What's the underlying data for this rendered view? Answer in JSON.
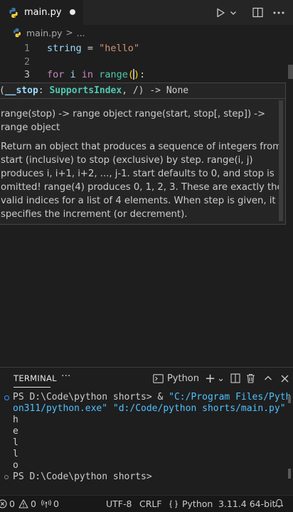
{
  "tab": {
    "filename": "main.py"
  },
  "breadcrumb": {
    "file": "main.py",
    "separator": ">",
    "symbol": "..."
  },
  "editor": {
    "lines": [
      {
        "number": "1",
        "tokens": [
          "string",
          " = ",
          "\"hello\""
        ]
      },
      {
        "number": "2"
      },
      {
        "number": "3",
        "tokens": [
          "for",
          " i ",
          "in",
          " ",
          "range",
          "(",
          ")",
          ":"
        ]
      }
    ]
  },
  "hover": {
    "signature": {
      "open": "(",
      "param": "__stop",
      "colon": ": ",
      "type": "SupportsIndex",
      "rest": ", /) -> None"
    },
    "doc1": "range(stop) -> range object range(start, stop[, step]) -> range object",
    "doc2": "Return an object that produces a sequence of integers from start (inclusive) to stop (exclusive) by step. range(i, j) produces i, i+1, i+2, ..., j-1. start defaults to 0, and stop is omitted! range(4) produces 0, 1, 2, 3. These are exactly the valid indices for a list of 4 elements. When step is given, it specifies the increment (or decrement)."
  },
  "panel": {
    "tab_label": "TERMINAL",
    "more": "···",
    "shell": "Python",
    "add": "+",
    "dropdown": "⌄"
  },
  "terminal": {
    "cmd_prompt": "PS D:\\Code\\python shorts> & ",
    "cmd_path1": "\"C:/Program Files/Pyth",
    "cmd_path2": "on311/python.exe\"",
    "cmd_path3": "\"d:/Code/python shorts/main.py\"",
    "output": [
      "h",
      "e",
      "l",
      "l",
      "o"
    ],
    "final_prompt": "PS D:\\Code\\python shorts> "
  },
  "status": {
    "errors": "0",
    "warnings": "0",
    "ports": "0",
    "encoding": "UTF-8",
    "eol": "CRLF",
    "language": "Python",
    "interpreter": "3.11.4 64-bit"
  }
}
